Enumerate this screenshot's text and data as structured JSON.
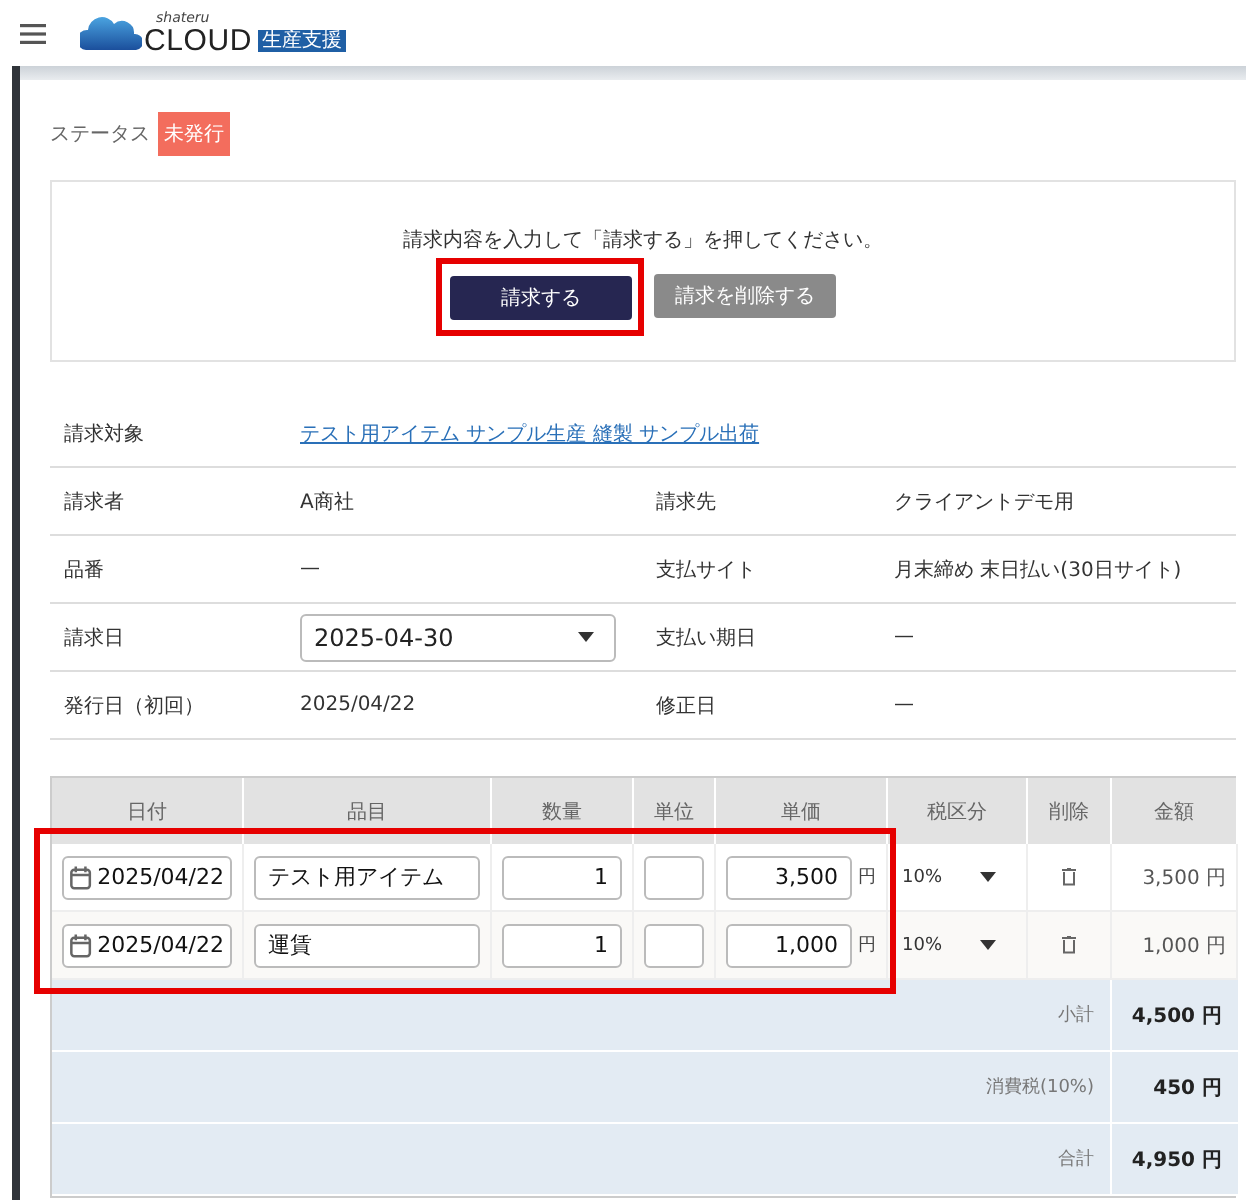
{
  "header": {
    "logo_small": "shateru",
    "logo_main": "CLOUD",
    "logo_badge": "生産支援"
  },
  "status": {
    "label": "ステータス",
    "badge": "未発行"
  },
  "action_panel": {
    "message": "請求内容を入力して「請求する」を押してください。",
    "primary_button": "請求する",
    "primary_highlighted": true,
    "secondary_button": "請求を削除する"
  },
  "info_rows": [
    [
      {
        "label": "請求対象",
        "value": "テスト用アイテム サンプル生産 縫製 サンプル出荷",
        "kind": "link"
      }
    ],
    [
      {
        "label": "請求者",
        "value": "A商社",
        "kind": "text"
      },
      {
        "label": "請求先",
        "value": "クライアントデモ用",
        "kind": "text"
      }
    ],
    [
      {
        "label": "品番",
        "value": "—",
        "kind": "text"
      },
      {
        "label": "支払サイト",
        "value": "月末締め 末日払い(30日サイト)",
        "kind": "text"
      }
    ],
    [
      {
        "label": "請求日",
        "value": "2025-04-30",
        "kind": "select"
      },
      {
        "label": "支払い期日",
        "value": "—",
        "kind": "text"
      }
    ],
    [
      {
        "label": "発行日（初回）",
        "value": "2025/04/22",
        "kind": "text"
      },
      {
        "label": "修正日",
        "value": "—",
        "kind": "text"
      }
    ]
  ],
  "line_items": {
    "columns": [
      "日付",
      "品目",
      "数量",
      "単位",
      "単価",
      "税区分",
      "削除",
      "金額"
    ],
    "rows_highlighted": true,
    "rows": [
      {
        "date": "2025/04/22",
        "item": "テスト用アイテム",
        "quantity": "1",
        "unit_price": "3,500",
        "yen": "円",
        "tax": "10%",
        "amount": "3,500 円"
      },
      {
        "date": "2025/04/22",
        "item": "運賃",
        "quantity": "1",
        "unit_price": "1,000",
        "yen": "円",
        "tax": "10%",
        "amount": "1,000 円"
      }
    ],
    "summary": [
      {
        "label": "小計",
        "value": "4,500 円"
      },
      {
        "label": "消費税(10%)",
        "value": "450 円"
      },
      {
        "label": "合計",
        "value": "4,950 円"
      }
    ]
  }
}
